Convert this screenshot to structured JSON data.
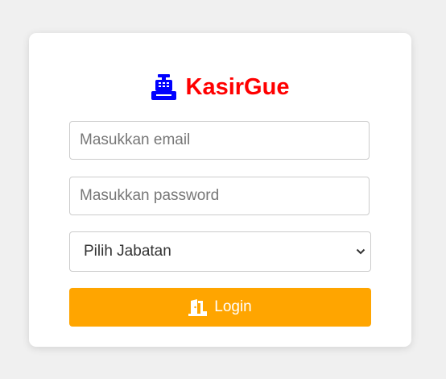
{
  "brand": {
    "title": "KasirGue",
    "icon": "cash-register-icon",
    "icon_color": "#0000ff",
    "title_color": "#ff0000"
  },
  "form": {
    "email_placeholder": "Masukkan email",
    "password_placeholder": "Masukkan password",
    "role_select": {
      "selected": "Pilih Jabatan"
    },
    "login_button": {
      "label": "Login",
      "icon": "door-open-icon",
      "color": "#ffa500"
    }
  },
  "colors": {
    "page_background": "#f0f0f0",
    "card_background": "#ffffff"
  }
}
